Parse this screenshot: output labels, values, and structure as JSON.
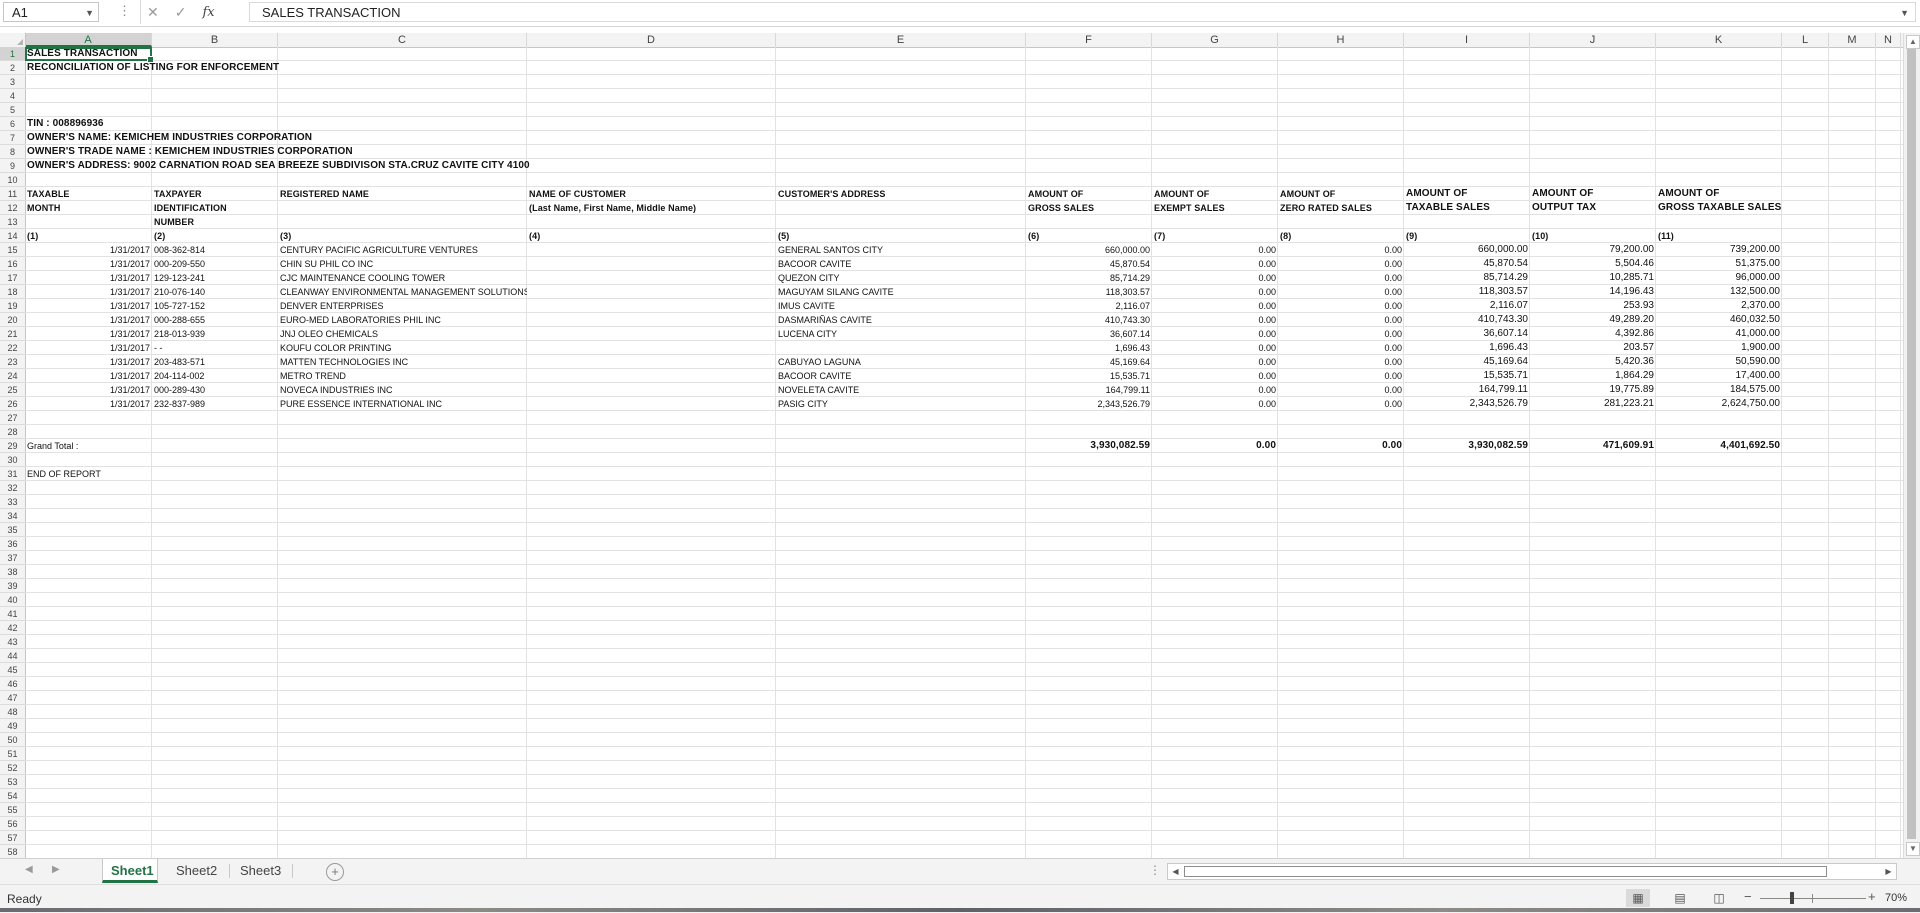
{
  "formula_bar": {
    "name_box": "A1",
    "cancel_icon": "✕",
    "enter_icon": "✓",
    "function_icon": "fx",
    "content": "SALES TRANSACTION"
  },
  "columns": [
    "A",
    "B",
    "C",
    "D",
    "E",
    "F",
    "G",
    "H",
    "I",
    "J",
    "K",
    "L",
    "M",
    "N"
  ],
  "row_numbers": [
    "1",
    "2",
    "3",
    "4",
    "5",
    "6",
    "7",
    "8",
    "9",
    "10",
    "11",
    "12",
    "13",
    "14",
    "15",
    "16",
    "17",
    "18",
    "19",
    "20",
    "21",
    "22",
    "23",
    "24",
    "25",
    "26",
    "27",
    "28",
    "29",
    "30",
    "31",
    "32",
    "33",
    "34",
    "35",
    "36",
    "37",
    "38",
    "39",
    "40",
    "41",
    "42",
    "43",
    "44",
    "45",
    "46",
    "47",
    "48",
    "49",
    "50",
    "51",
    "52",
    "53",
    "54",
    "55",
    "56",
    "57",
    "58"
  ],
  "sheet": {
    "title": "SALES TRANSACTION",
    "subtitle": "RECONCILIATION OF LISTING FOR ENFORCEMENT",
    "tin": "TIN : 008896936",
    "owner_name": "OWNER'S NAME: KEMICHEM INDUSTRIES CORPORATION",
    "trade_name": "OWNER'S TRADE NAME : KEMICHEM INDUSTRIES CORPORATION",
    "owner_address": "OWNER'S ADDRESS: 9002 CARNATION ROAD SEA BREEZE SUBDIVISON STA.CRUZ CAVITE CITY 4100",
    "headers": {
      "A": [
        "TAXABLE",
        "MONTH",
        ""
      ],
      "B": [
        "TAXPAYER",
        "IDENTIFICATION",
        "NUMBER"
      ],
      "C": [
        "REGISTERED NAME",
        "",
        ""
      ],
      "D": [
        "NAME OF CUSTOMER",
        "(Last Name, First Name, Middle Name)",
        ""
      ],
      "E": [
        "CUSTOMER'S ADDRESS",
        "",
        ""
      ],
      "F": [
        "AMOUNT OF",
        "GROSS SALES",
        ""
      ],
      "G": [
        "AMOUNT OF",
        "EXEMPT SALES",
        ""
      ],
      "H": [
        "AMOUNT OF",
        "ZERO RATED SALES",
        ""
      ],
      "I": [
        "AMOUNT OF",
        "TAXABLE SALES",
        ""
      ],
      "J": [
        "AMOUNT OF",
        "OUTPUT TAX",
        ""
      ],
      "K": [
        "AMOUNT OF",
        "GROSS TAXABLE SALES",
        ""
      ]
    },
    "col_numbers": [
      "(1)",
      "(2)",
      "(3)",
      "(4)",
      "(5)",
      "(6)",
      "(7)",
      "(8)",
      "(9)",
      "(10)",
      "(11)"
    ],
    "rows": [
      [
        "1/31/2017",
        "008-362-814",
        "CENTURY PACIFIC AGRICULTURE VENTURES",
        "",
        "GENERAL SANTOS CITY",
        "660,000.00",
        "0.00",
        "0.00",
        "660,000.00",
        "79,200.00",
        "739,200.00"
      ],
      [
        "1/31/2017",
        "000-209-550",
        "CHIN SU PHIL CO INC",
        "",
        "BACOOR CAVITE",
        "45,870.54",
        "0.00",
        "0.00",
        "45,870.54",
        "5,504.46",
        "51,375.00"
      ],
      [
        "1/31/2017",
        "129-123-241",
        "CJC MAINTENANCE COOLING TOWER",
        "",
        "QUEZON CITY",
        "85,714.29",
        "0.00",
        "0.00",
        "85,714.29",
        "10,285.71",
        "96,000.00"
      ],
      [
        "1/31/2017",
        "210-076-140",
        "CLEANWAY ENVIRONMENTAL MANAGEMENT SOLUTIONS",
        "",
        "MAGUYAM SILANG CAVITE",
        "118,303.57",
        "0.00",
        "0.00",
        "118,303.57",
        "14,196.43",
        "132,500.00"
      ],
      [
        "1/31/2017",
        "105-727-152",
        "DENVER ENTERPRISES",
        "",
        "IMUS CAVITE",
        "2,116.07",
        "0.00",
        "0.00",
        "2,116.07",
        "253.93",
        "2,370.00"
      ],
      [
        "1/31/2017",
        "000-288-655",
        "EURO-MED LABORATORIES PHIL INC",
        "",
        "DASMARIÑAS CAVITE",
        "410,743.30",
        "0.00",
        "0.00",
        "410,743.30",
        "49,289.20",
        "460,032.50"
      ],
      [
        "1/31/2017",
        "218-013-939",
        "JNJ OLEO CHEMICALS",
        "",
        "LUCENA CITY",
        "36,607.14",
        "0.00",
        "0.00",
        "36,607.14",
        "4,392.86",
        "41,000.00"
      ],
      [
        "1/31/2017",
        "  -  -",
        "KOUFU COLOR PRINTING",
        "",
        "",
        "1,696.43",
        "0.00",
        "0.00",
        "1,696.43",
        "203.57",
        "1,900.00"
      ],
      [
        "1/31/2017",
        "203-483-571",
        "MATTEN TECHNOLOGIES INC",
        "",
        "CABUYAO LAGUNA",
        "45,169.64",
        "0.00",
        "0.00",
        "45,169.64",
        "5,420.36",
        "50,590.00"
      ],
      [
        "1/31/2017",
        "204-114-002",
        "METRO TREND",
        "",
        "BACOOR CAVITE",
        "15,535.71",
        "0.00",
        "0.00",
        "15,535.71",
        "1,864.29",
        "17,400.00"
      ],
      [
        "1/31/2017",
        "000-289-430",
        "NOVECA INDUSTRIES INC",
        "",
        "NOVELETA CAVITE",
        "164,799.11",
        "0.00",
        "0.00",
        "164,799.11",
        "19,775.89",
        "184,575.00"
      ],
      [
        "1/31/2017",
        "232-837-989",
        "PURE ESSENCE INTERNATIONAL INC",
        "",
        "PASIG CITY",
        "2,343,526.79",
        "0.00",
        "0.00",
        "2,343,526.79",
        "281,223.21",
        "2,624,750.00"
      ]
    ],
    "grand_total_label": "Grand Total :",
    "grand_totals": [
      "3,930,082.59",
      "0.00",
      "0.00",
      "3,930,082.59",
      "471,609.91",
      "4,401,692.50"
    ],
    "end_label": "END OF REPORT"
  },
  "tabs": [
    "Sheet1",
    "Sheet2",
    "Sheet3"
  ],
  "active_tab": "Sheet1",
  "status": {
    "ready": "Ready",
    "zoom": "70%",
    "zoom_minus": "−",
    "zoom_plus": "+"
  },
  "colors": {
    "accent": "#217346"
  },
  "icons": {
    "name_box_dropdown": "chevron-down-icon",
    "cancel": "close-icon",
    "enter": "check-icon",
    "function": "fx-icon",
    "add_sheet": "plus-circle-icon",
    "view_normal": "grid-icon",
    "view_layout": "page-layout-icon",
    "view_break": "page-break-icon"
  }
}
